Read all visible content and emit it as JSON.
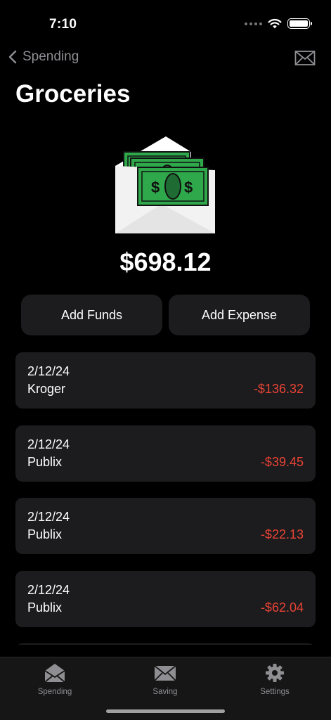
{
  "status_bar": {
    "time": "7:10"
  },
  "nav": {
    "back_label": "Spending"
  },
  "page": {
    "title": "Groceries"
  },
  "envelope": {
    "balance": "$698.12"
  },
  "actions": {
    "add_funds": "Add Funds",
    "add_expense": "Add Expense"
  },
  "transactions": [
    {
      "date": "2/12/24",
      "merchant": "Kroger",
      "amount": "-$136.32"
    },
    {
      "date": "2/12/24",
      "merchant": "Publix",
      "amount": "-$39.45"
    },
    {
      "date": "2/12/24",
      "merchant": "Publix",
      "amount": "-$22.13"
    },
    {
      "date": "2/12/24",
      "merchant": "Publix",
      "amount": "-$62.04"
    }
  ],
  "tab_bar": {
    "tabs": [
      {
        "label": "Spending",
        "icon": "open-envelope-icon"
      },
      {
        "label": "Saving",
        "icon": "envelope-icon"
      },
      {
        "label": "Settings",
        "icon": "gear-icon"
      }
    ]
  },
  "colors": {
    "negative_amount": "#ea4335",
    "card_background": "#1c1c1e",
    "money_green": "#2ea84a"
  }
}
